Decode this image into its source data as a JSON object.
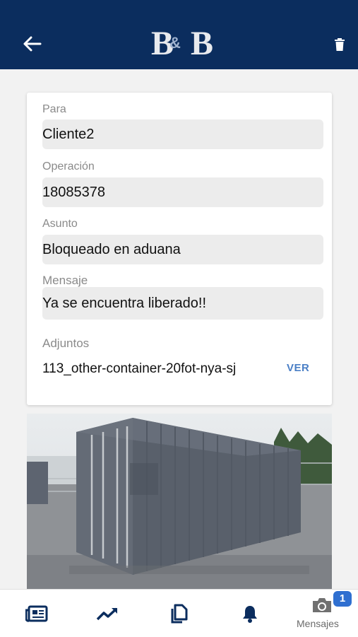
{
  "header": {
    "logo_text": "B&B",
    "background": "#0b2d5e"
  },
  "form": {
    "to_label": "Para",
    "to_value": "Cliente2",
    "operation_label": "Operación",
    "operation_value": "18085378",
    "subject_label": "Asunto",
    "subject_value": "Bloqueado en aduana",
    "message_label": "Mensaje",
    "message_value": "Ya se encuentra liberado!!",
    "attachments_label": "Adjuntos",
    "attachment_name": "113_other-container-20fot-nya-sj",
    "view_label": "VER"
  },
  "bottom_nav": {
    "items": [
      {
        "icon": "news-icon"
      },
      {
        "icon": "trending-up-icon"
      },
      {
        "icon": "documents-icon"
      },
      {
        "icon": "bell-icon"
      },
      {
        "icon": "camera-icon",
        "label": "Mensajes",
        "badge": "1"
      }
    ]
  },
  "colors": {
    "accent": "#2f6fd0",
    "link": "#4a7fc6",
    "nav_icon": "#0b2d5e"
  }
}
